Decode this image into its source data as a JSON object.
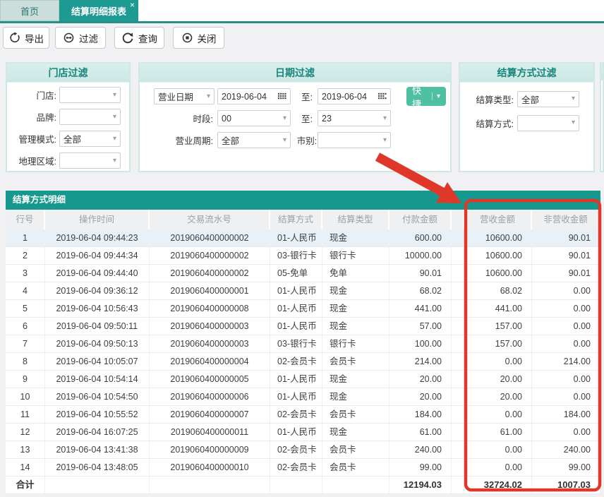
{
  "tabs": {
    "home": "首页",
    "report": "结算明细报表"
  },
  "icons": {
    "caret": "▾",
    "tab_close": "×"
  },
  "toolbar": {
    "export": "导出",
    "filter": "过滤",
    "query": "查询",
    "close": "关闭"
  },
  "store_panel": {
    "title": "门店过滤",
    "fields": [
      {
        "label": "门店:",
        "value": ""
      },
      {
        "label": "品牌:",
        "value": ""
      },
      {
        "label": "管理模式:",
        "value": "全部"
      },
      {
        "label": "地理区域:",
        "value": ""
      }
    ]
  },
  "date_panel": {
    "title": "日期过滤",
    "date_type": "营业日期",
    "date_from": "2019-06-04",
    "to_label": "至:",
    "date_to": "2019-06-04",
    "quick_button": "快捷",
    "hour_label": "时段:",
    "hour_from": "00",
    "hour_to_label": "至:",
    "hour_to": "23",
    "cycle_label": "营业周期:",
    "cycle_value": "全部",
    "market_label": "市别:",
    "market_value": ""
  },
  "settle_panel": {
    "title": "结算方式过滤",
    "fields": [
      {
        "label": "结算类型:",
        "value": "全部"
      },
      {
        "label": "结算方式:",
        "value": ""
      }
    ]
  },
  "table": {
    "title": "结算方式明细",
    "columns": [
      "行号",
      "操作时间",
      "交易流水号",
      "结算方式",
      "结算类型",
      "付款金额",
      "营收金额",
      "非营收金额"
    ],
    "rows": [
      [
        "1",
        "2019-06-04 09:44:23",
        "2019060400000002",
        "01-人民币",
        "现金",
        "600.00",
        "10600.00",
        "90.01"
      ],
      [
        "2",
        "2019-06-04 09:44:34",
        "2019060400000002",
        "03-银行卡",
        "银行卡",
        "10000.00",
        "10600.00",
        "90.01"
      ],
      [
        "3",
        "2019-06-04 09:44:40",
        "2019060400000002",
        "05-免单",
        "免单",
        "90.01",
        "10600.00",
        "90.01"
      ],
      [
        "4",
        "2019-06-04 09:36:12",
        "2019060400000001",
        "01-人民币",
        "现金",
        "68.02",
        "68.02",
        "0.00"
      ],
      [
        "5",
        "2019-06-04 10:56:43",
        "2019060400000008",
        "01-人民币",
        "现金",
        "441.00",
        "441.00",
        "0.00"
      ],
      [
        "6",
        "2019-06-04 09:50:11",
        "2019060400000003",
        "01-人民币",
        "现金",
        "57.00",
        "157.00",
        "0.00"
      ],
      [
        "7",
        "2019-06-04 09:50:13",
        "2019060400000003",
        "03-银行卡",
        "银行卡",
        "100.00",
        "157.00",
        "0.00"
      ],
      [
        "8",
        "2019-06-04 10:05:07",
        "2019060400000004",
        "02-会员卡",
        "会员卡",
        "214.00",
        "0.00",
        "214.00"
      ],
      [
        "9",
        "2019-06-04 10:54:14",
        "2019060400000005",
        "01-人民币",
        "现金",
        "20.00",
        "20.00",
        "0.00"
      ],
      [
        "10",
        "2019-06-04 10:54:50",
        "2019060400000006",
        "01-人民币",
        "现金",
        "20.00",
        "20.00",
        "0.00"
      ],
      [
        "11",
        "2019-06-04 10:55:52",
        "2019060400000007",
        "02-会员卡",
        "会员卡",
        "184.00",
        "0.00",
        "184.00"
      ],
      [
        "12",
        "2019-06-04 16:07:25",
        "2019060400000011",
        "01-人民币",
        "现金",
        "61.00",
        "61.00",
        "0.00"
      ],
      [
        "13",
        "2019-06-04 13:41:38",
        "2019060400000009",
        "02-会员卡",
        "会员卡",
        "240.00",
        "0.00",
        "240.00"
      ],
      [
        "14",
        "2019-06-04 13:48:05",
        "2019060400000010",
        "02-会员卡",
        "会员卡",
        "99.00",
        "0.00",
        "99.00"
      ]
    ],
    "total_row": [
      "合计",
      "",
      "",
      "",
      "",
      "12194.03",
      "32724.02",
      "1007.03"
    ]
  },
  "colors": {
    "accent_teal": "#1d9a91",
    "panel_header_teal": "#17857c",
    "quick_button_green": "#4ec1a3",
    "annotation_red": "#df382a",
    "selected_row_blue": "#e8f1f7"
  }
}
